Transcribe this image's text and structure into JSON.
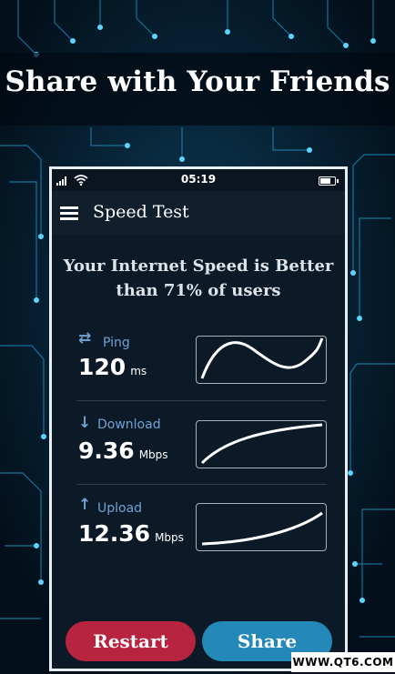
{
  "banner": {
    "title": "Share with Your Friends"
  },
  "status_bar": {
    "time": "05:19",
    "icons": [
      "signal-icon",
      "wifi-icon",
      "battery-icon"
    ]
  },
  "app_bar": {
    "title": "Speed Test",
    "menu_icon": "hamburger-menu-icon"
  },
  "headline": {
    "line1": "Your Internet Speed is Better",
    "line2": "than 71% of users"
  },
  "metrics": [
    {
      "arrow": "⇄",
      "label": "Ping",
      "value": "120",
      "unit": "ms"
    },
    {
      "arrow": "↓",
      "label": "Download",
      "value": "9.36",
      "unit": "Mbps"
    },
    {
      "arrow": "↑",
      "label": "Upload",
      "value": "12.36",
      "unit": "Mbps"
    }
  ],
  "buttons": {
    "restart": "Restart",
    "share": "Share"
  },
  "watermark": "WWW.QT6.COM",
  "colors": {
    "restart": "#b8243f",
    "share": "#2489b9",
    "accent": "#6fa2d4"
  }
}
